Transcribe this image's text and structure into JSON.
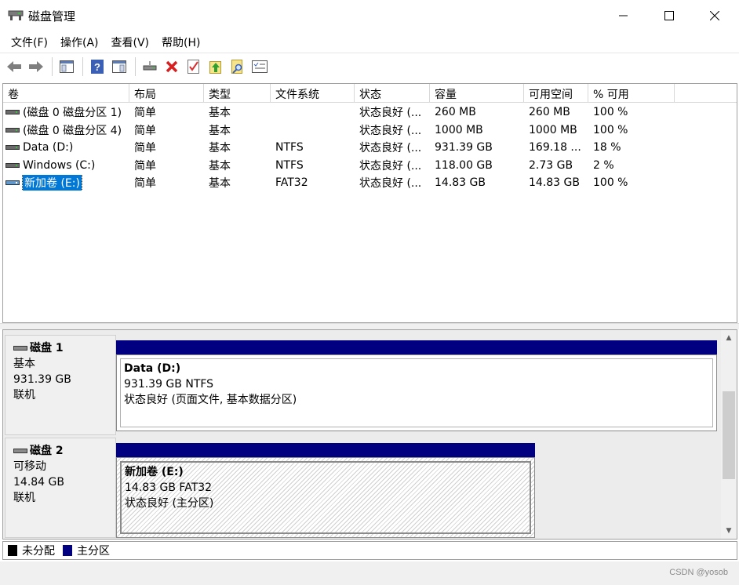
{
  "window": {
    "title": "磁盘管理"
  },
  "menu": [
    "文件(F)",
    "操作(A)",
    "查看(V)",
    "帮助(H)"
  ],
  "toolbar": {
    "icons": [
      "back-arrow-icon",
      "forward-arrow-icon",
      "console-tree-icon",
      "help-icon",
      "properties-icon",
      "connect-icon",
      "delete-icon",
      "check-icon",
      "up-icon",
      "search-icon",
      "list-icon"
    ]
  },
  "volume_list": {
    "columns": [
      "卷",
      "布局",
      "类型",
      "文件系统",
      "状态",
      "容量",
      "可用空间",
      "% 可用"
    ],
    "rows": [
      {
        "vol": "(磁盘 0 磁盘分区 1)",
        "layout": "简单",
        "type": "基本",
        "fs": "",
        "status": "状态良好 (...",
        "capacity": "260 MB",
        "free": "260 MB",
        "pct": "100 %"
      },
      {
        "vol": "(磁盘 0 磁盘分区 4)",
        "layout": "简单",
        "type": "基本",
        "fs": "",
        "status": "状态良好 (...",
        "capacity": "1000 MB",
        "free": "1000 MB",
        "pct": "100 %"
      },
      {
        "vol": "Data (D:)",
        "layout": "简单",
        "type": "基本",
        "fs": "NTFS",
        "status": "状态良好 (...",
        "capacity": "931.39 GB",
        "free": "169.18 ...",
        "pct": "18 %"
      },
      {
        "vol": "Windows (C:)",
        "layout": "简单",
        "type": "基本",
        "fs": "NTFS",
        "status": "状态良好 (...",
        "capacity": "118.00 GB",
        "free": "2.73 GB",
        "pct": "2 %"
      },
      {
        "vol": "新加卷 (E:)",
        "layout": "简单",
        "type": "基本",
        "fs": "FAT32",
        "status": "状态良好 (...",
        "capacity": "14.83 GB",
        "free": "14.83 GB",
        "pct": "100 %"
      }
    ],
    "selected_index": 4
  },
  "disks": [
    {
      "name": "磁盘 1",
      "kind": "基本",
      "size": "931.39 GB",
      "state": "联机",
      "partition": {
        "title": "Data  (D:)",
        "detail": "931.39 GB NTFS",
        "status": "状态良好 (页面文件, 基本数据分区)"
      }
    },
    {
      "name": "磁盘 2",
      "kind": "可移动",
      "size": "14.84 GB",
      "state": "联机",
      "partition": {
        "title": "新加卷  (E:)",
        "detail": "14.83 GB FAT32",
        "status": "状态良好 (主分区)"
      }
    }
  ],
  "legend": {
    "unallocated": "未分配",
    "primary": "主分区",
    "unallocated_color": "#000000",
    "primary_color": "#000080"
  },
  "watermark": "CSDN @yosob"
}
